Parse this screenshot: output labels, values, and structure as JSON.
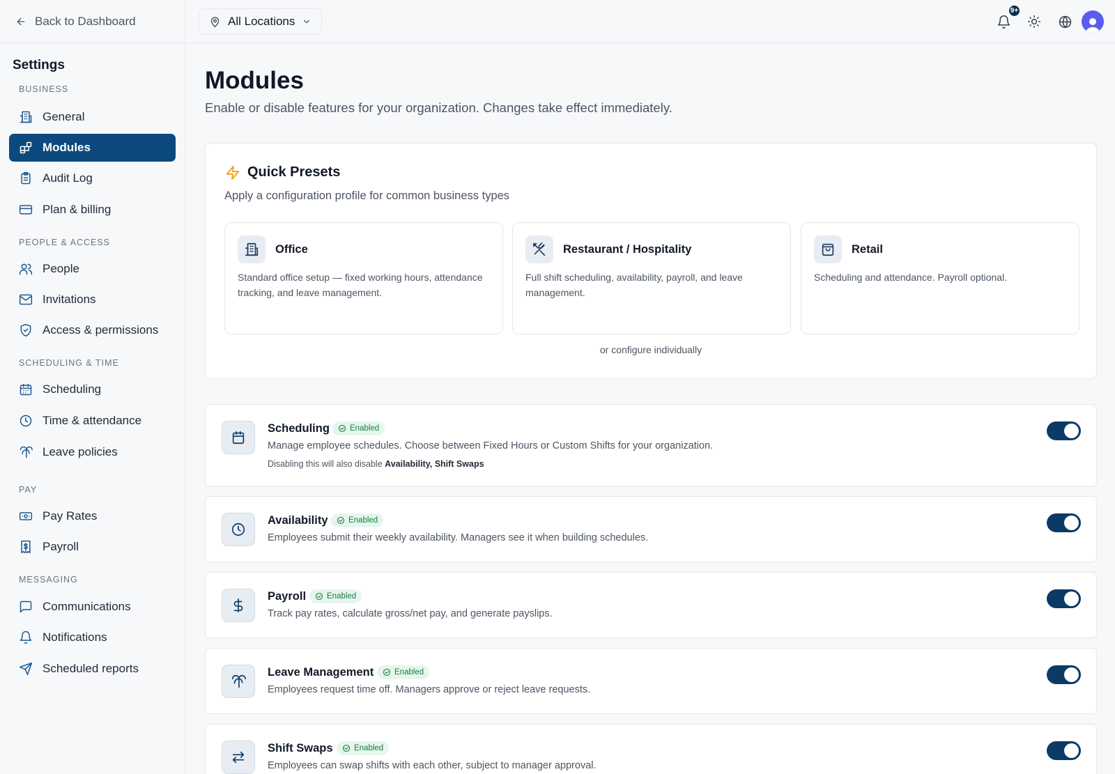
{
  "sidebar": {
    "back_label": "Back to Dashboard",
    "title": "Settings",
    "sections": {
      "business": "BUSINESS",
      "people": "PEOPLE & ACCESS",
      "scheduling": "SCHEDULING & TIME",
      "pay": "PAY",
      "messaging": "MESSAGING"
    },
    "items": {
      "general": "General",
      "modules": "Modules",
      "audit_log": "Audit Log",
      "plan_billing": "Plan & billing",
      "people": "People",
      "invitations": "Invitations",
      "access": "Access & permissions",
      "scheduling": "Scheduling",
      "time_attendance": "Time & attendance",
      "leave_policies": "Leave policies",
      "pay_rates": "Pay Rates",
      "payroll": "Payroll",
      "communications": "Communications",
      "notifications": "Notifications",
      "scheduled_reports": "Scheduled reports"
    },
    "active_item": "Modules"
  },
  "topbar": {
    "location": "All Locations",
    "notification_count": "9+"
  },
  "page": {
    "title": "Modules",
    "subtitle": "Enable or disable features for your organization. Changes take effect immediately."
  },
  "presets": {
    "title": "Quick Presets",
    "subtitle": "Apply a configuration profile for common business types",
    "items": [
      {
        "name": "Office",
        "description": "Standard office setup — fixed working hours, attendance tracking, and leave management."
      },
      {
        "name": "Restaurant / Hospitality",
        "description": "Full shift scheduling, availability, payroll, and leave management."
      },
      {
        "name": "Retail",
        "description": "Scheduling and attendance. Payroll optional."
      }
    ],
    "or_configure": "or configure individually"
  },
  "modules": [
    {
      "name": "Scheduling",
      "status": "Enabled",
      "enabled": true,
      "description": "Manage employee schedules. Choose between Fixed Hours or Custom Shifts for your organization.",
      "note_prefix": "Disabling this will also disable ",
      "note_dependents": "Availability, Shift Swaps"
    },
    {
      "name": "Availability",
      "status": "Enabled",
      "enabled": true,
      "description": "Employees submit their weekly availability. Managers see it when building schedules."
    },
    {
      "name": "Payroll",
      "status": "Enabled",
      "enabled": true,
      "description": "Track pay rates, calculate gross/net pay, and generate payslips."
    },
    {
      "name": "Leave Management",
      "status": "Enabled",
      "enabled": true,
      "description": "Employees request time off. Managers approve or reject leave requests."
    },
    {
      "name": "Shift Swaps",
      "status": "Enabled",
      "enabled": true,
      "description": "Employees can swap shifts with each other, subject to manager approval."
    }
  ],
  "colors": {
    "primary": "#0c4a7e",
    "toggle_on": "#0c3a66",
    "enabled_badge_bg": "#e6f6ee",
    "enabled_badge_text": "#15803d",
    "preset_accent": "#f59e0b",
    "avatar": "#5b5bf0"
  },
  "icons": {
    "back": "arrow-left-icon",
    "location": "map-pin-icon",
    "notifications": "bell-icon",
    "theme": "sun-icon",
    "language": "globe-icon",
    "quick_presets": "lightning-icon"
  }
}
